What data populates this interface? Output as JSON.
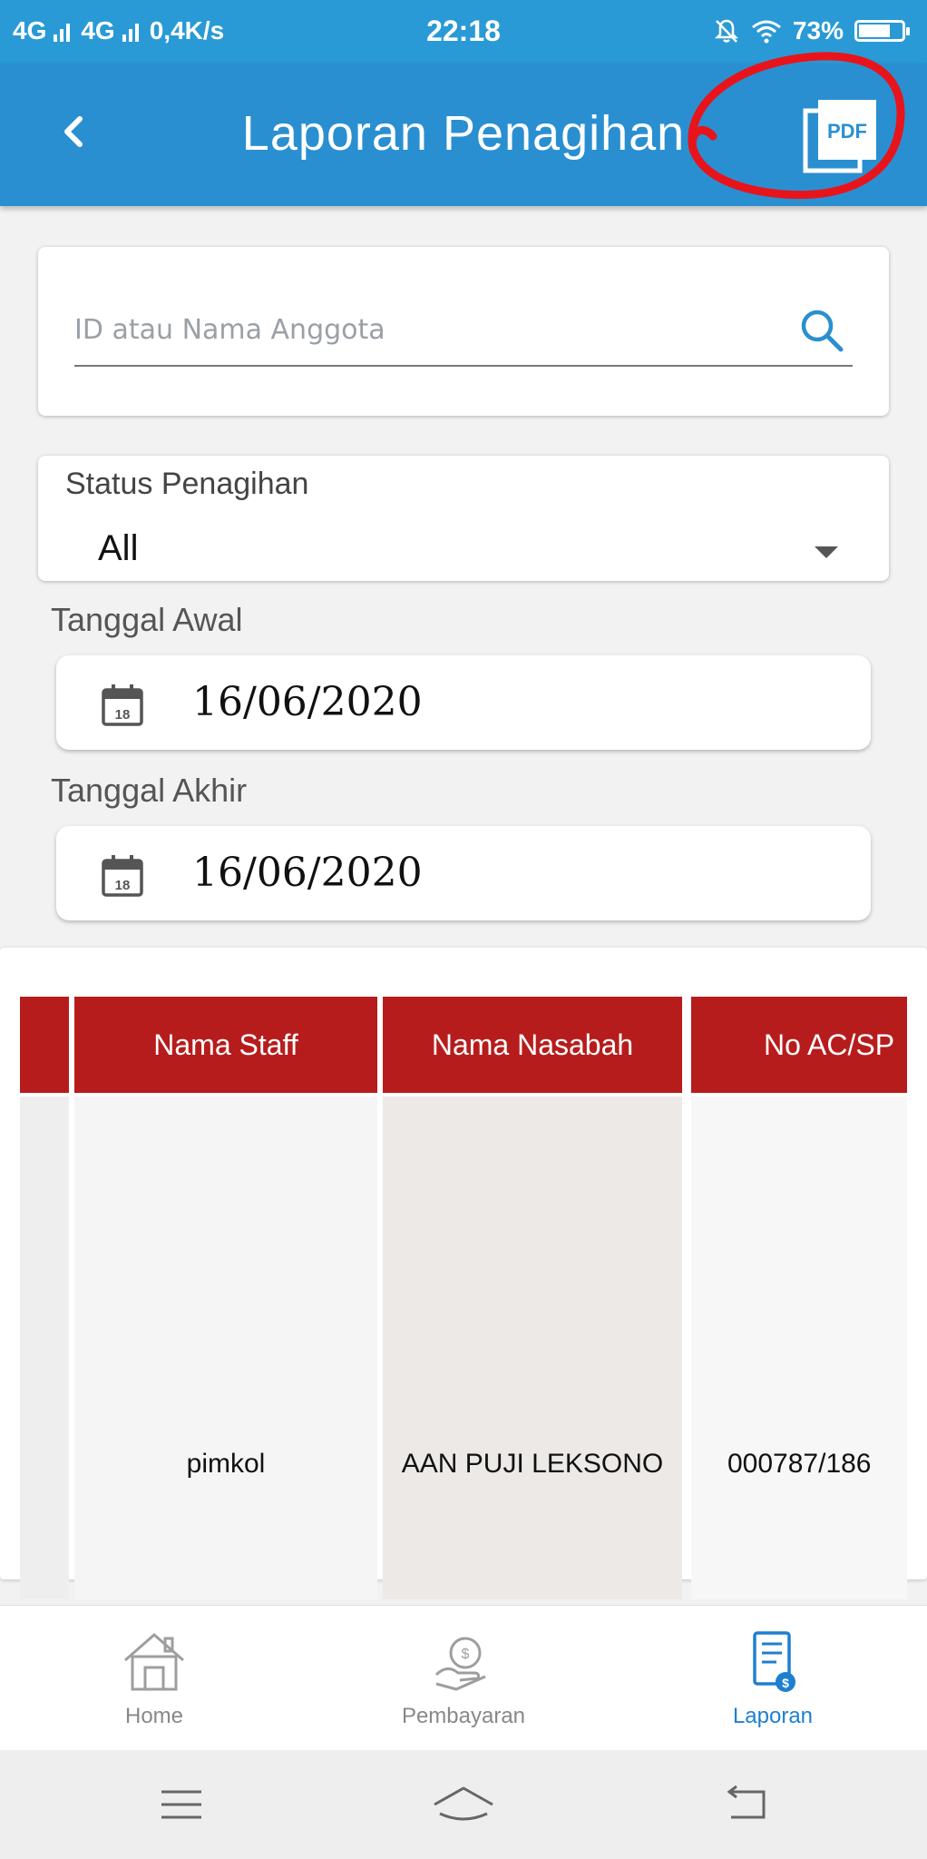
{
  "status_bar": {
    "network_1": "4G",
    "network_2": "4G",
    "speed": "0,4K/s",
    "time": "22:18",
    "battery_percent": "73%",
    "battery_level": 0.73
  },
  "app_bar": {
    "title": "Laporan Penagihan",
    "pdf_label": "PDF",
    "accent_color": "#2a8fd0",
    "annotation_color": "#e8141c"
  },
  "search": {
    "placeholder": "ID atau Nama Anggota"
  },
  "status_filter": {
    "label": "Status Penagihan",
    "selected": "All"
  },
  "date_start": {
    "label": "Tanggal Awal",
    "value": "16/06/2020",
    "calendar_day": "18"
  },
  "date_end": {
    "label": "Tanggal Akhir",
    "value": "16/06/2020",
    "calendar_day": "18"
  },
  "table": {
    "header_color": "#b71c1c",
    "columns": [
      "Nama Staff",
      "Nama Nasabah",
      "No AC/SP"
    ],
    "rows": [
      [
        "pimkol",
        "AAN PUJI LEKSONO",
        "000787/186"
      ]
    ]
  },
  "bottom_nav": {
    "items": [
      {
        "label": "Home",
        "icon": "home-icon"
      },
      {
        "label": "Pembayaran",
        "icon": "payment-icon"
      },
      {
        "label": "Laporan",
        "icon": "report-icon"
      }
    ],
    "active": "Laporan"
  }
}
